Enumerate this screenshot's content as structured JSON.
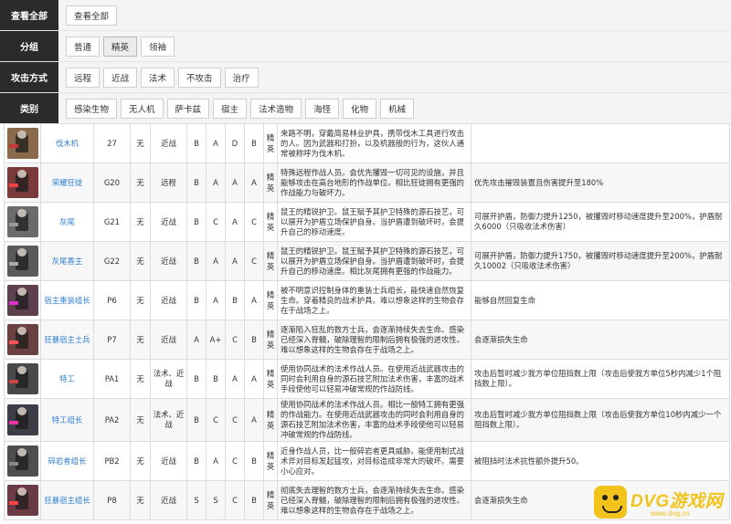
{
  "filters": {
    "view_all": {
      "label": "查看全部",
      "button": "查看全部"
    },
    "group": {
      "label": "分组",
      "options": [
        "普通",
        "精英",
        "领袖"
      ],
      "active": 1
    },
    "attack": {
      "label": "攻击方式",
      "options": [
        "远程",
        "近战",
        "法术",
        "不攻击",
        "治疗"
      ]
    },
    "category": {
      "label": "类别",
      "options": [
        "感染生物",
        "无人机",
        "萨卡兹",
        "宿主",
        "法术造物",
        "海怪",
        "化物",
        "机械"
      ]
    }
  },
  "colors": {
    "label_bg": "#2b2b2b",
    "link": "#2f7fd1",
    "watermark": "#f2c31b"
  },
  "rows": [
    {
      "name": "伐木机",
      "code": "27",
      "c3": "无",
      "attack": "近战",
      "s1": "B",
      "s2": "A",
      "s3": "D",
      "s4": "B",
      "elite": "精英",
      "desc": "来路不明，穿戴简易林业护具，携带伐木工具进行攻击的人。因为武器和打扮，以及机器般的行为，这伙人通常被称呼为伐木机。",
      "feature": "",
      "portrait": {
        "bg": "#8a6a4a",
        "acc": "#c33"
      }
    },
    {
      "name": "荣耀狂徒",
      "code": "G20",
      "c3": "无",
      "attack": "远程",
      "s1": "B",
      "s2": "A",
      "s3": "A",
      "s4": "A",
      "elite": "精英",
      "desc": "特殊远程作战人员。会优先攫毁一切可见的设施，并且能够攻击在高台地形的作战单位。相比狂徒拥有更强的作战能力与破坏力。",
      "feature": "优先攻击摧毁装置且伤害提升至180%",
      "portrait": {
        "bg": "#7a3a3a",
        "acc": "#e44"
      }
    },
    {
      "name": "灰尾",
      "code": "G21",
      "c3": "无",
      "attack": "近战",
      "s1": "B",
      "s2": "C",
      "s3": "A",
      "s4": "C",
      "elite": "精英",
      "desc": "鼠王的精锐护卫。鼠王赋予其护卫特殊的源石技艺，可以展开为护盾立场保护自身。当护盾遭到破坏时，会提升自己的移动速度。",
      "feature": "可展开护盾，防御力提升1250，被攫毁时移动速度提升至200%，护盾耐久6000（只吸收法术伤害）",
      "portrait": {
        "bg": "#6b6b6b",
        "acc": "#999"
      }
    },
    {
      "name": "灰尾香主",
      "code": "G22",
      "c3": "无",
      "attack": "近战",
      "s1": "B",
      "s2": "A",
      "s3": "A",
      "s4": "C",
      "elite": "精英",
      "desc": "鼠王的精锐护卫。鼠王赋予其护卫特殊的源石技艺，可以展开为护盾立场保护自身。当护盾遭到破坏时，会提升自己的移动速度。相比灰尾拥有更强的作战能力。",
      "feature": "可展开护盾，防御力提升1750，被攫毁时移动速度提升至200%，护盾耐久10002（只吸收法术伤害）",
      "portrait": {
        "bg": "#5a5a5a",
        "acc": "#aaa"
      }
    },
    {
      "name": "宿主重装组长",
      "code": "P6",
      "c3": "无",
      "attack": "近战",
      "s1": "B",
      "s2": "A",
      "s3": "B",
      "s4": "A",
      "elite": "精英",
      "desc": "被不明意识控制身体的重装士兵组长，能快速自然恢复生命。穿着精良的战术护具。难以想象这样的生物会存在于战场之上。",
      "feature": "能够自然回复生命",
      "portrait": {
        "bg": "#5e3f4e",
        "acc": "#d3c"
      }
    },
    {
      "name": "狂暴宿主士兵",
      "code": "P7",
      "c3": "无",
      "attack": "近战",
      "s1": "A",
      "s2": "A+",
      "s3": "C",
      "s4": "B",
      "elite": "精英",
      "desc": "逐渐陷入狂乱的数方士兵，会逐渐持续失去生命。感染已经深入脊髓，破除理智的限制后拥有极强的进攻性。难以想象这样的生物会存在于战场之上。",
      "feature": "会逐渐损失生命",
      "portrait": {
        "bg": "#6a4040",
        "acc": "#f55"
      }
    },
    {
      "name": "特工",
      "code": "PA1",
      "c3": "无",
      "attack": "法术、近战",
      "s1": "B",
      "s2": "B",
      "s3": "A",
      "s4": "A",
      "elite": "精英",
      "desc": "使用协同战术的法术作战人员。在使用近战武器攻击的同时会利用自身的源石技艺附加法术伤害，丰富的战术手段使他可以轻易冲破常规的作战防线。",
      "feature": "攻击后暂时减少我方单位阻挡数上限（攻击后使我方单位5秒内减少1个阻挡数上限）。",
      "portrait": {
        "bg": "#4a4a4a",
        "acc": "#c44"
      }
    },
    {
      "name": "特工组长",
      "code": "PA2",
      "c3": "无",
      "attack": "法术、近战",
      "s1": "B",
      "s2": "C",
      "s3": "C",
      "s4": "A",
      "elite": "精英",
      "desc": "使用协同战术的法术作战人员。相比一般特工拥有更强的作战能力。在使用近战武器攻击的同时会利用自身的源石技艺附加法术伤害，丰富的战术手段使他可以轻易冲破常规的作战防线。",
      "feature": "攻击后暂时减少我方单位阻挡数上限（攻击后使我方单位10秒内减少一个阻挡数上限）。",
      "portrait": {
        "bg": "#3d3d48",
        "acc": "#e3a"
      }
    },
    {
      "name": "碎岩者组长",
      "code": "PB2",
      "c3": "无",
      "attack": "近战",
      "s1": "B",
      "s2": "A",
      "s3": "C",
      "s4": "B",
      "elite": "精英",
      "desc": "近身作战人员，比一般碎岩者更具威胁。能使用制式战术斧对目标发起猛攻，对目标造成非常大的破坏。需要小心应对。",
      "feature": "被阻挡时法术抗性额外提升50。",
      "portrait": {
        "bg": "#4e4e4e",
        "acc": "#888"
      }
    },
    {
      "name": "狂暴宿主组长",
      "code": "P8",
      "c3": "无",
      "attack": "近战",
      "s1": "S",
      "s2": "S",
      "s3": "C",
      "s4": "B",
      "elite": "精英",
      "desc": "彻底失去理智的数方士兵，会逐渐持续失去生命。感染已经深入脊髓，破除理智的限制后拥有极强的进攻性。难以想象这样的生物会存在于战场之上。",
      "feature": "会逐渐损失生命",
      "portrait": {
        "bg": "#6a3a45",
        "acc": "#f44"
      }
    }
  ],
  "watermark": {
    "text": "DVG游戏网",
    "url": "www.dvg.cn"
  }
}
